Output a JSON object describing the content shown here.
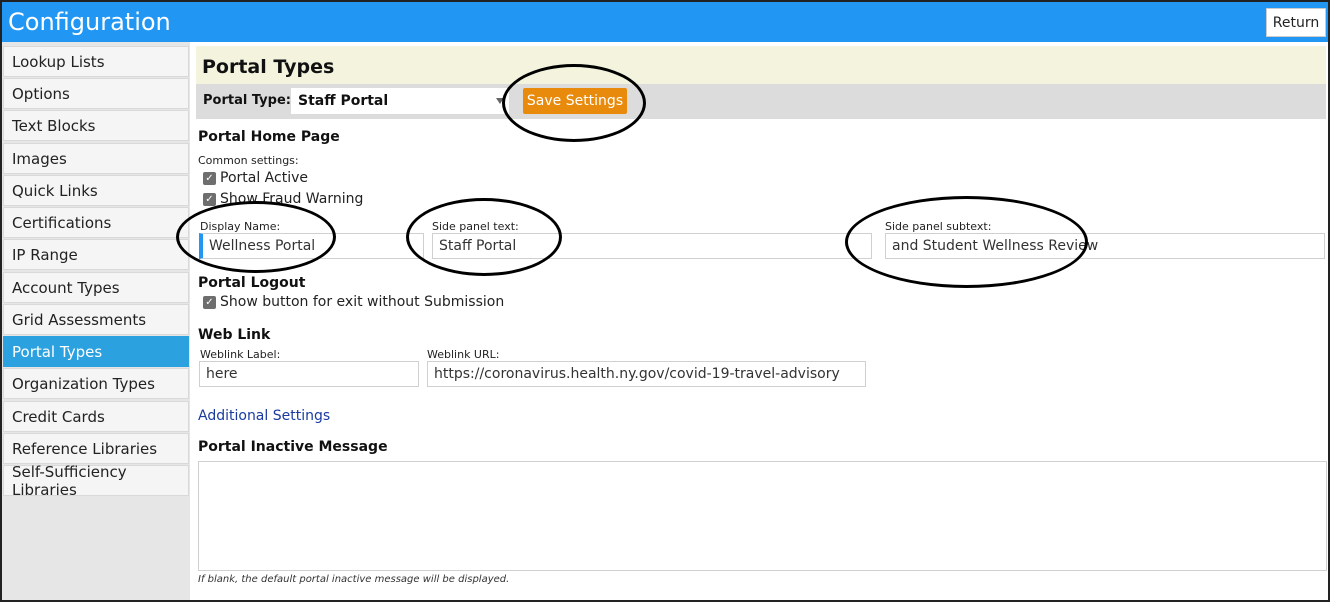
{
  "app": {
    "title": "Configuration",
    "return_label": "Return"
  },
  "sidebar": {
    "items": [
      {
        "label": "Lookup Lists",
        "active": false
      },
      {
        "label": "Options",
        "active": false
      },
      {
        "label": "Text Blocks",
        "active": false
      },
      {
        "label": "Images",
        "active": false
      },
      {
        "label": "Quick Links",
        "active": false
      },
      {
        "label": "Certifications",
        "active": false
      },
      {
        "label": "IP Range",
        "active": false
      },
      {
        "label": "Account Types",
        "active": false
      },
      {
        "label": "Grid Assessments",
        "active": false
      },
      {
        "label": "Portal Types",
        "active": true
      },
      {
        "label": "Organization Types",
        "active": false
      },
      {
        "label": "Credit Cards",
        "active": false
      },
      {
        "label": "Reference Libraries",
        "active": false
      },
      {
        "label": "Self-Sufficiency Libraries",
        "active": false
      }
    ]
  },
  "main": {
    "page_title": "Portal Types",
    "toolbar": {
      "portal_type_label": "Portal Type:",
      "portal_type_value": "Staff Portal",
      "save_label": "Save Settings"
    },
    "home_page": {
      "title": "Portal Home Page",
      "common_settings_label": "Common settings:",
      "portal_active_label": "Portal Active",
      "portal_active_checked": true,
      "fraud_warning_label": "Show Fraud Warning",
      "fraud_warning_checked": true,
      "display_name_label": "Display Name:",
      "display_name_value": "Wellness Portal",
      "side_panel_text_label": "Side panel text:",
      "side_panel_text_value": "Staff Portal",
      "side_panel_subtext_label": "Side panel subtext:",
      "side_panel_subtext_value": "and Student Wellness Review"
    },
    "logout": {
      "title": "Portal Logout",
      "exit_button_label": "Show button for exit without Submission",
      "exit_button_checked": true
    },
    "web_link": {
      "title": "Web Link",
      "label_label": "Weblink Label:",
      "label_value": "here",
      "url_label": "Weblink URL:",
      "url_value": "https://coronavirus.health.ny.gov/covid-19-travel-advisory"
    },
    "additional_settings_label": "Additional Settings",
    "inactive_message": {
      "title": "Portal Inactive Message",
      "value": "",
      "hint": "If blank, the default portal inactive message will be displayed."
    }
  },
  "icons": {
    "checkbox": "check-icon",
    "dropdown": "chevron-down-icon"
  },
  "colors": {
    "topbar": "#2196f3",
    "save_button": "#e88a0c",
    "active_nav": "#2ba1e0",
    "link": "#1a3aa0"
  }
}
